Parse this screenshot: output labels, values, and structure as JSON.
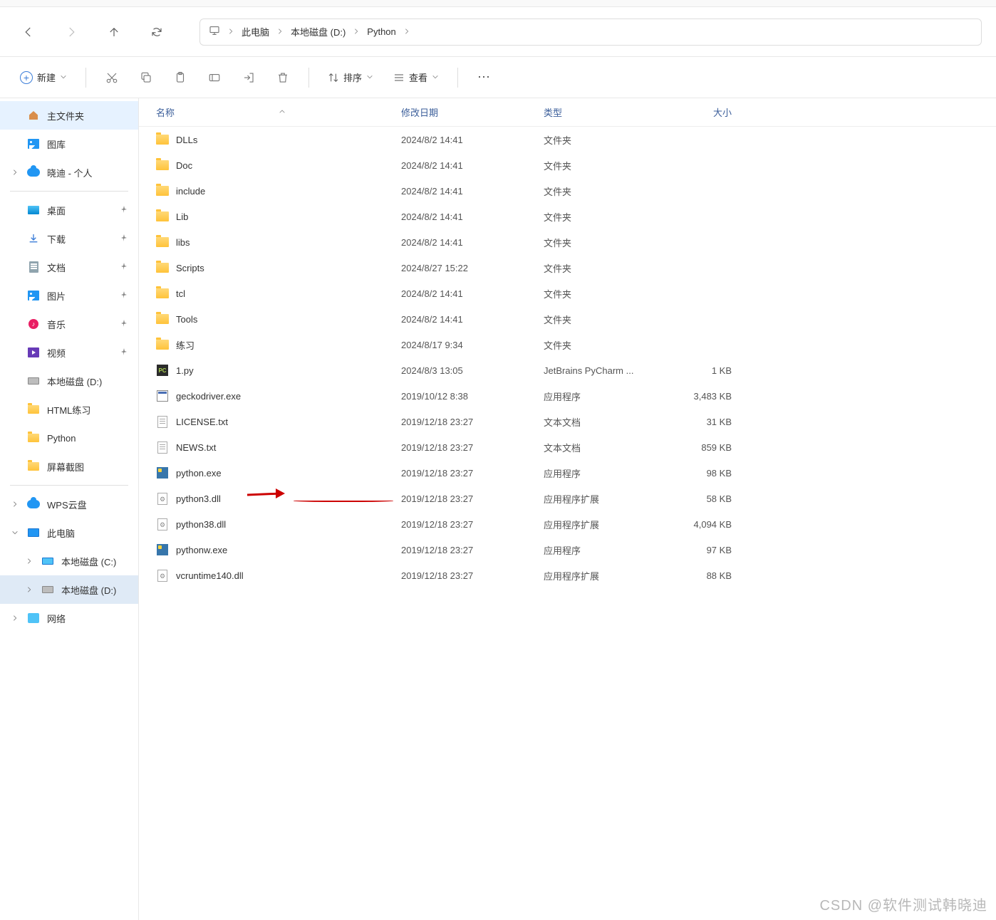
{
  "breadcrumb": {
    "root": "此电脑",
    "disk": "本地磁盘 (D:)",
    "folder": "Python"
  },
  "toolbar": {
    "new_label": "新建",
    "sort_label": "排序",
    "view_label": "查看"
  },
  "sidebar": {
    "home": "主文件夹",
    "gallery": "图库",
    "personal": "晓迪 - 个人",
    "desktop": "桌面",
    "downloads": "下载",
    "documents": "文档",
    "pictures": "图片",
    "music": "音乐",
    "videos": "视频",
    "disk_d": "本地磁盘 (D:)",
    "html_practice": "HTML练习",
    "python": "Python",
    "screenshots": "屏幕截图",
    "wps": "WPS云盘",
    "this_pc": "此电脑",
    "disk_c": "本地磁盘 (C:)",
    "disk_d2": "本地磁盘 (D:)",
    "network": "网络"
  },
  "columns": {
    "name": "名称",
    "date": "修改日期",
    "type": "类型",
    "size": "大小"
  },
  "files": [
    {
      "icon": "folder",
      "name": "DLLs",
      "date": "2024/8/2 14:41",
      "type": "文件夹",
      "size": ""
    },
    {
      "icon": "folder",
      "name": "Doc",
      "date": "2024/8/2 14:41",
      "type": "文件夹",
      "size": ""
    },
    {
      "icon": "folder",
      "name": "include",
      "date": "2024/8/2 14:41",
      "type": "文件夹",
      "size": ""
    },
    {
      "icon": "folder",
      "name": "Lib",
      "date": "2024/8/2 14:41",
      "type": "文件夹",
      "size": ""
    },
    {
      "icon": "folder",
      "name": "libs",
      "date": "2024/8/2 14:41",
      "type": "文件夹",
      "size": ""
    },
    {
      "icon": "folder",
      "name": "Scripts",
      "date": "2024/8/27 15:22",
      "type": "文件夹",
      "size": ""
    },
    {
      "icon": "folder",
      "name": "tcl",
      "date": "2024/8/2 14:41",
      "type": "文件夹",
      "size": ""
    },
    {
      "icon": "folder",
      "name": "Tools",
      "date": "2024/8/2 14:41",
      "type": "文件夹",
      "size": ""
    },
    {
      "icon": "folder",
      "name": "练习",
      "date": "2024/8/17 9:34",
      "type": "文件夹",
      "size": ""
    },
    {
      "icon": "py",
      "name": "1.py",
      "date": "2024/8/3 13:05",
      "type": "JetBrains PyCharm ...",
      "size": "1 KB"
    },
    {
      "icon": "exe",
      "name": "geckodriver.exe",
      "date": "2019/10/12 8:38",
      "type": "应用程序",
      "size": "3,483 KB"
    },
    {
      "icon": "txt",
      "name": "LICENSE.txt",
      "date": "2019/12/18 23:27",
      "type": "文本文档",
      "size": "31 KB"
    },
    {
      "icon": "txt",
      "name": "NEWS.txt",
      "date": "2019/12/18 23:27",
      "type": "文本文档",
      "size": "859 KB"
    },
    {
      "icon": "pyexe",
      "name": "python.exe",
      "date": "2019/12/18 23:27",
      "type": "应用程序",
      "size": "98 KB"
    },
    {
      "icon": "dll",
      "name": "python3.dll",
      "date": "2019/12/18 23:27",
      "type": "应用程序扩展",
      "size": "58 KB"
    },
    {
      "icon": "dll",
      "name": "python38.dll",
      "date": "2019/12/18 23:27",
      "type": "应用程序扩展",
      "size": "4,094 KB"
    },
    {
      "icon": "pyexe",
      "name": "pythonw.exe",
      "date": "2019/12/18 23:27",
      "type": "应用程序",
      "size": "97 KB"
    },
    {
      "icon": "dll",
      "name": "vcruntime140.dll",
      "date": "2019/12/18 23:27",
      "type": "应用程序扩展",
      "size": "88 KB"
    }
  ],
  "watermark": "CSDN @软件测试韩晓迪"
}
